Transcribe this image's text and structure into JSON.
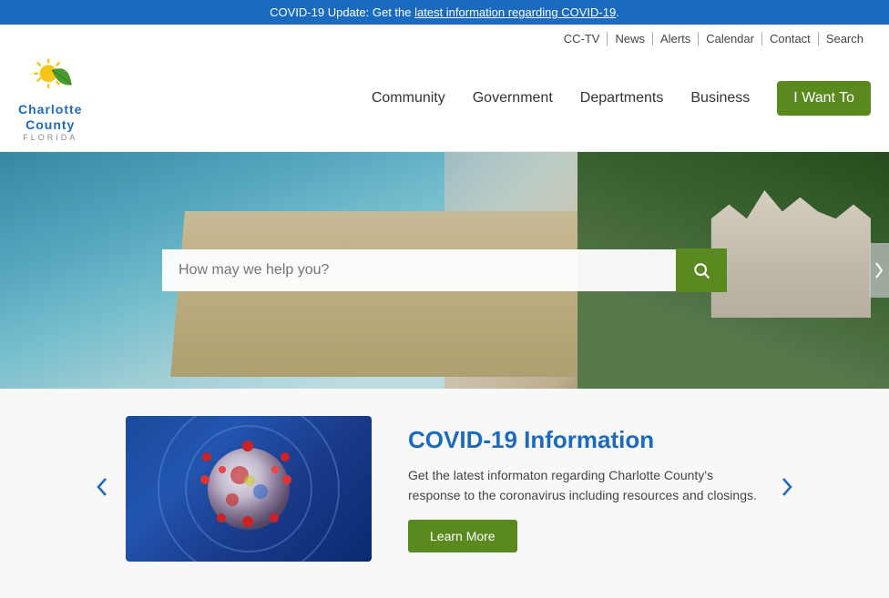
{
  "banner": {
    "text": "COVID-19 Update: Get the ",
    "link_text": "latest information regarding COVID-19",
    "link_url": "#"
  },
  "utility_nav": {
    "items": [
      "CC-TV",
      "News",
      "Alerts",
      "Calendar",
      "Contact",
      "Search"
    ]
  },
  "logo": {
    "charlotte": "Charlotte",
    "county": "County",
    "florida": "FLORIDA"
  },
  "main_nav": {
    "items": [
      "Community",
      "Government",
      "Departments",
      "Business"
    ],
    "cta_label": "I Want To"
  },
  "hero": {
    "search_placeholder": "How may we help you?"
  },
  "card": {
    "title": "COVID-19 Information",
    "description": "Get the latest informaton regarding Charlotte County's response to the coronavirus including resources and closings.",
    "button_label": "Learn More"
  },
  "icons": {
    "search": "🔍",
    "chevron_left": "❮",
    "chevron_right": "❯"
  }
}
